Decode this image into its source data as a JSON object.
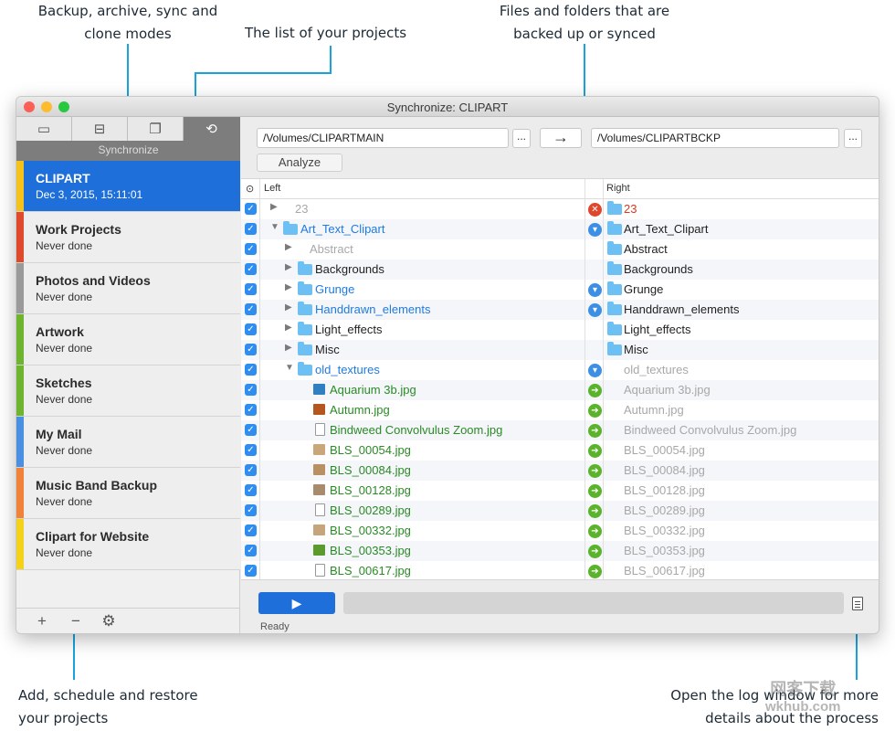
{
  "annotations": {
    "modes_line1": "Backup, archive, sync and",
    "modes_line2": "clone modes",
    "projects_list": "The list of your projects",
    "files_line1": "Files and folders that are",
    "files_line2": "backed up or synced",
    "add_line1": "Add, schedule and restore",
    "add_line2": "your projects",
    "log_line1": "Open the log window for more",
    "log_line2": "details about the process"
  },
  "watermark": {
    "line1": "网客下载",
    "line2": "wkhub.com"
  },
  "window": {
    "title": "Synchronize: CLIPART"
  },
  "modes": {
    "active_label": "Synchronize",
    "icons": [
      "archive-icon",
      "backup-icon",
      "clone-icon",
      "sync-icon"
    ]
  },
  "projects": [
    {
      "name": "CLIPART",
      "date": "Dec 3, 2015, 15:11:01",
      "color": "#f4c21b"
    },
    {
      "name": "Work Projects",
      "date": "Never done",
      "color": "#e04a2c"
    },
    {
      "name": "Photos and Videos",
      "date": "Never done",
      "color": "#9a9a9a"
    },
    {
      "name": "Artwork",
      "date": "Never done",
      "color": "#6eb42f"
    },
    {
      "name": "Sketches",
      "date": "Never done",
      "color": "#6eb42f"
    },
    {
      "name": "My Mail",
      "date": "Never done",
      "color": "#4a90e2"
    },
    {
      "name": "Music Band Backup",
      "date": "Never done",
      "color": "#f0823a"
    },
    {
      "name": "Clipart for Website",
      "date": "Never done",
      "color": "#f4d21b"
    }
  ],
  "sidebar_footer": {
    "add": "+",
    "remove": "−",
    "settings": "⚙"
  },
  "paths": {
    "left": "/Volumes/CLIPARTMAIN",
    "right": "/Volumes/CLIPARTBCKP",
    "browse": "...",
    "direction": "→"
  },
  "analyze_label": "Analyze",
  "table": {
    "left_header": "Left",
    "right_header": "Right",
    "rows": [
      {
        "left": "23",
        "right": "23",
        "type": "plain",
        "indent": 0,
        "tri": "▶",
        "lcolor": "gray",
        "rcolor": "red",
        "action": "x",
        "rfolder": true
      },
      {
        "left": "Art_Text_Clipart",
        "right": "Art_Text_Clipart",
        "type": "folder",
        "indent": 0,
        "tri": "▼",
        "lcolor": "blue",
        "rcolor": "black",
        "action": "down",
        "rfolder": true
      },
      {
        "left": "Abstract",
        "right": "Abstract",
        "type": "plain",
        "indent": 1,
        "tri": "▶",
        "lcolor": "gray",
        "rcolor": "black",
        "action": "",
        "rfolder": true
      },
      {
        "left": "Backgrounds",
        "right": "Backgrounds",
        "type": "folder",
        "indent": 1,
        "tri": "▶",
        "lcolor": "black",
        "rcolor": "black",
        "action": "",
        "rfolder": true
      },
      {
        "left": "Grunge",
        "right": "Grunge",
        "type": "folder",
        "indent": 1,
        "tri": "▶",
        "lcolor": "blue",
        "rcolor": "black",
        "action": "down",
        "rfolder": true
      },
      {
        "left": "Handdrawn_elements",
        "right": "Handdrawn_elements",
        "type": "folder",
        "indent": 1,
        "tri": "▶",
        "lcolor": "blue",
        "rcolor": "black",
        "action": "down",
        "rfolder": true
      },
      {
        "left": "Light_effects",
        "right": "Light_effects",
        "type": "folder",
        "indent": 1,
        "tri": "▶",
        "lcolor": "black",
        "rcolor": "black",
        "action": "",
        "rfolder": true
      },
      {
        "left": "Misc",
        "right": "Misc",
        "type": "folder",
        "indent": 1,
        "tri": "▶",
        "lcolor": "black",
        "rcolor": "black",
        "action": "",
        "rfolder": true
      },
      {
        "left": "old_textures",
        "right": "old_textures",
        "type": "folder",
        "indent": 1,
        "tri": "▼",
        "lcolor": "blue",
        "rcolor": "gray",
        "action": "down",
        "rfolder": false
      },
      {
        "left": "Aquarium 3b.jpg",
        "right": "Aquarium 3b.jpg",
        "type": "img",
        "thumb": "#2f7fc1",
        "indent": 2,
        "tri": "",
        "lcolor": "green",
        "rcolor": "gray",
        "action": "right",
        "rfolder": false
      },
      {
        "left": "Autumn.jpg",
        "right": "Autumn.jpg",
        "type": "img",
        "thumb": "#b5561f",
        "indent": 2,
        "tri": "",
        "lcolor": "green",
        "rcolor": "gray",
        "action": "right",
        "rfolder": false
      },
      {
        "left": "Bindweed Convolvulus Zoom.jpg",
        "right": "Bindweed Convolvulus Zoom.jpg",
        "type": "doc",
        "indent": 2,
        "tri": "",
        "lcolor": "green",
        "rcolor": "gray",
        "action": "right",
        "rfolder": false
      },
      {
        "left": "BLS_00054.jpg",
        "right": "BLS_00054.jpg",
        "type": "img",
        "thumb": "#c9a77a",
        "indent": 2,
        "tri": "",
        "lcolor": "green",
        "rcolor": "gray",
        "action": "right",
        "rfolder": false
      },
      {
        "left": "BLS_00084.jpg",
        "right": "BLS_00084.jpg",
        "type": "img",
        "thumb": "#b99064",
        "indent": 2,
        "tri": "",
        "lcolor": "green",
        "rcolor": "gray",
        "action": "right",
        "rfolder": false
      },
      {
        "left": "BLS_00128.jpg",
        "right": "BLS_00128.jpg",
        "type": "img",
        "thumb": "#a88b6c",
        "indent": 2,
        "tri": "",
        "lcolor": "green",
        "rcolor": "gray",
        "action": "right",
        "rfolder": false
      },
      {
        "left": "BLS_00289.jpg",
        "right": "BLS_00289.jpg",
        "type": "doc",
        "indent": 2,
        "tri": "",
        "lcolor": "green",
        "rcolor": "gray",
        "action": "right",
        "rfolder": false
      },
      {
        "left": "BLS_00332.jpg",
        "right": "BLS_00332.jpg",
        "type": "img",
        "thumb": "#c6a57c",
        "indent": 2,
        "tri": "",
        "lcolor": "green",
        "rcolor": "gray",
        "action": "right",
        "rfolder": false
      },
      {
        "left": "BLS_00353.jpg",
        "right": "BLS_00353.jpg",
        "type": "img",
        "thumb": "#5b9a2d",
        "indent": 2,
        "tri": "",
        "lcolor": "green",
        "rcolor": "gray",
        "action": "right",
        "rfolder": false
      },
      {
        "left": "BLS_00617.jpg",
        "right": "BLS_00617.jpg",
        "type": "doc",
        "indent": 2,
        "tri": "",
        "lcolor": "green",
        "rcolor": "gray",
        "action": "right",
        "rfolder": false
      }
    ]
  },
  "run_label": "▶",
  "status": "Ready",
  "progress": 0
}
